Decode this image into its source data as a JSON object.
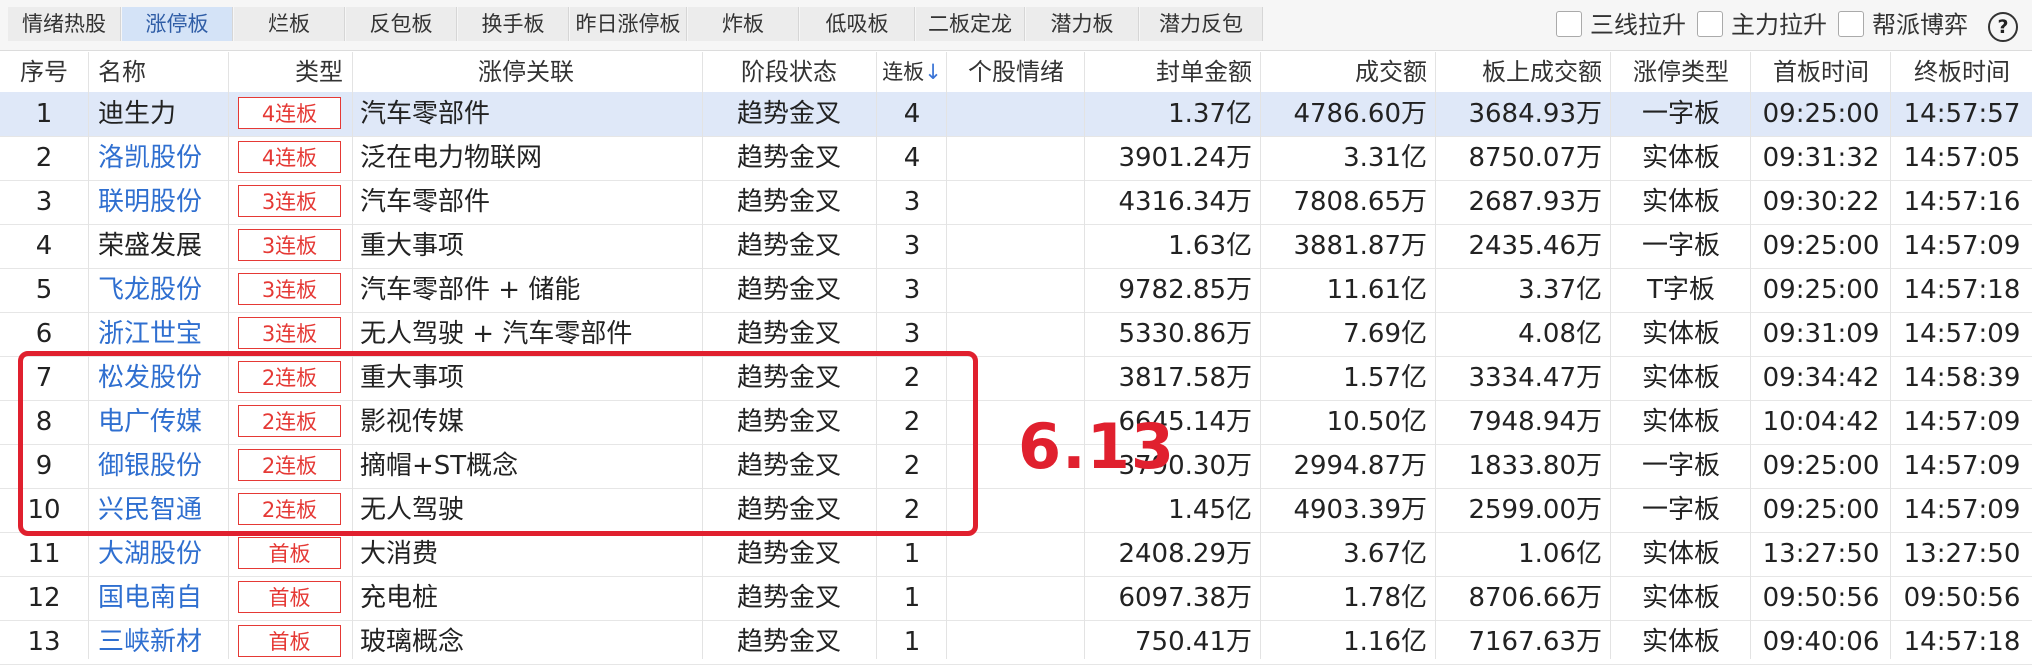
{
  "tabs": [
    {
      "label": "情绪热股",
      "active": false
    },
    {
      "label": "涨停板",
      "active": true
    },
    {
      "label": "烂板",
      "active": false
    },
    {
      "label": "反包板",
      "active": false
    },
    {
      "label": "换手板",
      "active": false
    },
    {
      "label": "昨日涨停板",
      "active": false
    },
    {
      "label": "炸板",
      "active": false
    },
    {
      "label": "低吸板",
      "active": false
    },
    {
      "label": "二板定龙",
      "active": false
    },
    {
      "label": "潜力板",
      "active": false
    },
    {
      "label": "潜力反包",
      "active": false
    }
  ],
  "options": [
    {
      "label": "三线拉升",
      "checked": false
    },
    {
      "label": "主力拉升",
      "checked": false
    },
    {
      "label": "帮派博弈",
      "checked": false
    }
  ],
  "help_label": "?",
  "columns": {
    "idx": "序号",
    "name": "名称",
    "type": "类型",
    "reason": "涨停关联",
    "stage": "阶段状态",
    "boards": "连板",
    "sort_icon": "↓",
    "sentiment": "个股情绪",
    "seal": "封单金额",
    "volume": "成交额",
    "board_volume": "板上成交额",
    "limit_type": "涨停类型",
    "first_time": "首板时间",
    "last_time": "终板时间"
  },
  "rows": [
    {
      "idx": "1",
      "name": "迪生力",
      "name_link": false,
      "type": "4连板",
      "reason": "汽车零部件",
      "stage": "趋势金叉",
      "boards": "4",
      "seal": "1.37亿",
      "volume": "4786.60万",
      "board_volume": "3684.93万",
      "limit_type": "一字板",
      "first_time": "09:25:00",
      "last_time": "14:57:57",
      "selected": true
    },
    {
      "idx": "2",
      "name": "洛凯股份",
      "name_link": true,
      "type": "4连板",
      "reason": "泛在电力物联网",
      "stage": "趋势金叉",
      "boards": "4",
      "seal": "3901.24万",
      "volume": "3.31亿",
      "board_volume": "8750.07万",
      "limit_type": "实体板",
      "first_time": "09:31:32",
      "last_time": "14:57:05"
    },
    {
      "idx": "3",
      "name": "联明股份",
      "name_link": true,
      "type": "3连板",
      "reason": "汽车零部件",
      "stage": "趋势金叉",
      "boards": "3",
      "seal": "4316.34万",
      "volume": "7808.65万",
      "board_volume": "2687.93万",
      "limit_type": "实体板",
      "first_time": "09:30:22",
      "last_time": "14:57:16"
    },
    {
      "idx": "4",
      "name": "荣盛发展",
      "name_link": false,
      "type": "3连板",
      "reason": "重大事项",
      "stage": "趋势金叉",
      "boards": "3",
      "seal": "1.63亿",
      "volume": "3881.87万",
      "board_volume": "2435.46万",
      "limit_type": "一字板",
      "first_time": "09:25:00",
      "last_time": "14:57:09"
    },
    {
      "idx": "5",
      "name": "飞龙股份",
      "name_link": true,
      "type": "3连板",
      "reason": "汽车零部件 + 储能",
      "stage": "趋势金叉",
      "boards": "3",
      "seal": "9782.85万",
      "volume": "11.61亿",
      "board_volume": "3.37亿",
      "limit_type": "T字板",
      "first_time": "09:25:00",
      "last_time": "14:57:18"
    },
    {
      "idx": "6",
      "name": "浙江世宝",
      "name_link": true,
      "type": "3连板",
      "reason": "无人驾驶 + 汽车零部件",
      "stage": "趋势金叉",
      "boards": "3",
      "seal": "5330.86万",
      "volume": "7.69亿",
      "board_volume": "4.08亿",
      "limit_type": "实体板",
      "first_time": "09:31:09",
      "last_time": "14:57:09"
    },
    {
      "idx": "7",
      "name": "松发股份",
      "name_link": true,
      "type": "2连板",
      "reason": "重大事项",
      "stage": "趋势金叉",
      "boards": "2",
      "seal": "3817.58万",
      "volume": "1.57亿",
      "board_volume": "3334.47万",
      "limit_type": "实体板",
      "first_time": "09:34:42",
      "last_time": "14:58:39"
    },
    {
      "idx": "8",
      "name": "电广传媒",
      "name_link": true,
      "type": "2连板",
      "reason": "影视传媒",
      "stage": "趋势金叉",
      "boards": "2",
      "seal": "6645.14万",
      "volume": "10.50亿",
      "board_volume": "7948.94万",
      "limit_type": "实体板",
      "first_time": "10:04:42",
      "last_time": "14:57:09"
    },
    {
      "idx": "9",
      "name": "御银股份",
      "name_link": true,
      "type": "2连板",
      "reason": "摘帽+ST概念",
      "stage": "趋势金叉",
      "boards": "2",
      "seal": "3790.30万",
      "volume": "2994.87万",
      "board_volume": "1833.80万",
      "limit_type": "一字板",
      "first_time": "09:25:00",
      "last_time": "14:57:09"
    },
    {
      "idx": "10",
      "name": "兴民智通",
      "name_link": true,
      "type": "2连板",
      "reason": "无人驾驶",
      "stage": "趋势金叉",
      "boards": "2",
      "seal": "1.45亿",
      "volume": "4903.39万",
      "board_volume": "2599.00万",
      "limit_type": "一字板",
      "first_time": "09:25:00",
      "last_time": "14:57:09"
    },
    {
      "idx": "11",
      "name": "大湖股份",
      "name_link": true,
      "type": "首板",
      "reason": "大消费",
      "stage": "趋势金叉",
      "boards": "1",
      "seal": "2408.29万",
      "volume": "3.67亿",
      "board_volume": "1.06亿",
      "limit_type": "实体板",
      "first_time": "13:27:50",
      "last_time": "13:27:50"
    },
    {
      "idx": "12",
      "name": "国电南自",
      "name_link": true,
      "type": "首板",
      "reason": "充电桩",
      "stage": "趋势金叉",
      "boards": "1",
      "seal": "6097.38万",
      "volume": "1.78亿",
      "board_volume": "8706.66万",
      "limit_type": "实体板",
      "first_time": "09:50:56",
      "last_time": "09:50:56"
    },
    {
      "idx": "13",
      "name": "三峡新材",
      "name_link": true,
      "type": "首板",
      "reason": "玻璃概念",
      "stage": "趋势金叉",
      "boards": "1",
      "seal": "750.41万",
      "volume": "1.16亿",
      "board_volume": "7167.63万",
      "limit_type": "实体板",
      "first_time": "09:40:06",
      "last_time": "14:57:18"
    }
  ],
  "annotation": "6.13",
  "colors": {
    "accent": "#2f6fd0",
    "badge": "#e53935",
    "highlight": "#e0202e",
    "selected_row": "#dfe8f8"
  }
}
